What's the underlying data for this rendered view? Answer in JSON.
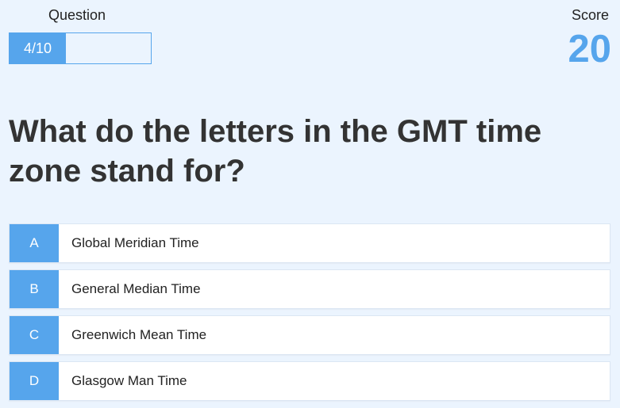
{
  "hud": {
    "question_label": "Question",
    "progress_text": "4/10",
    "progress_fraction": 0.4,
    "score_label": "Score",
    "score_value": "20"
  },
  "question": {
    "text": "What do the letters in the GMT time zone stand for?"
  },
  "choices": [
    {
      "prefix": "A",
      "text": "Global Meridian Time"
    },
    {
      "prefix": "B",
      "text": "General Median Time"
    },
    {
      "prefix": "C",
      "text": "Greenwich Mean Time"
    },
    {
      "prefix": "D",
      "text": "Glasgow Man Time"
    }
  ],
  "colors": {
    "accent": "#56a5ec",
    "background": "#ebf4fe",
    "text": "#333333",
    "choice_background": "#ffffff"
  }
}
